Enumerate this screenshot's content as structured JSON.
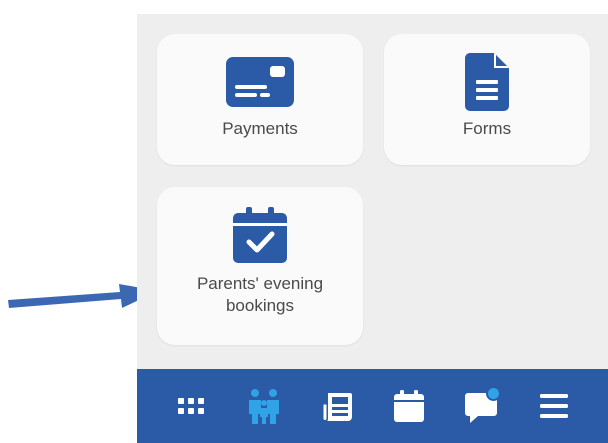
{
  "tiles": {
    "payments": {
      "label": "Payments",
      "icon": "credit-card-icon"
    },
    "forms": {
      "label": "Forms",
      "icon": "document-icon"
    },
    "parents_evening": {
      "label": "Parents' evening\nbookings",
      "icon": "calendar-check-icon"
    }
  },
  "bottom_nav": {
    "items": [
      {
        "icon": "grid-menu-icon",
        "active": false
      },
      {
        "icon": "family-icon",
        "active": true
      },
      {
        "icon": "newspaper-icon",
        "active": false
      },
      {
        "icon": "calendar-icon",
        "active": false
      },
      {
        "icon": "chat-bubble-icon",
        "active": false,
        "notification": true
      },
      {
        "icon": "hamburger-menu-icon",
        "active": false
      }
    ]
  },
  "colors": {
    "primary": "#2b5aa7",
    "accent": "#2fa3e6",
    "panel_bg": "#eeeeee",
    "tile_bg": "#fafafa",
    "label_text": "#4a4a4a",
    "arrow": "#3c68b3"
  }
}
